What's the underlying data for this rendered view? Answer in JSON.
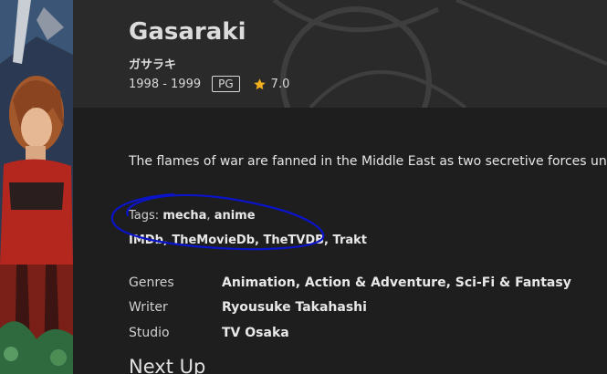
{
  "item": {
    "title": "Gasaraki",
    "original_title": "ガサラキ",
    "years": "1998 - 1999",
    "rating_badge": "PG",
    "community_rating": "7.0",
    "overview": "The flames of war are fanned in the Middle East as two secretive forces unle"
  },
  "tags": {
    "label": "Tags:",
    "items": [
      "mecha",
      "anime"
    ]
  },
  "external_links": [
    "IMDb",
    "TheMovieDb",
    "TheTVDB",
    "Trakt"
  ],
  "details": {
    "genres_label": "Genres",
    "genres_value": "Animation, Action & Adventure, Sci-Fi & Fantasy",
    "writer_label": "Writer",
    "writer_value": "Ryousuke Takahashi",
    "studio_label": "Studio",
    "studio_value": "TV Osaka"
  },
  "next_up": "Next Up",
  "colors": {
    "background": "#1e1e1e",
    "header": "#2a2a2a",
    "star": "#f2b01e",
    "annotation": "#0b14c8"
  },
  "icons": {
    "star": "star-icon"
  }
}
